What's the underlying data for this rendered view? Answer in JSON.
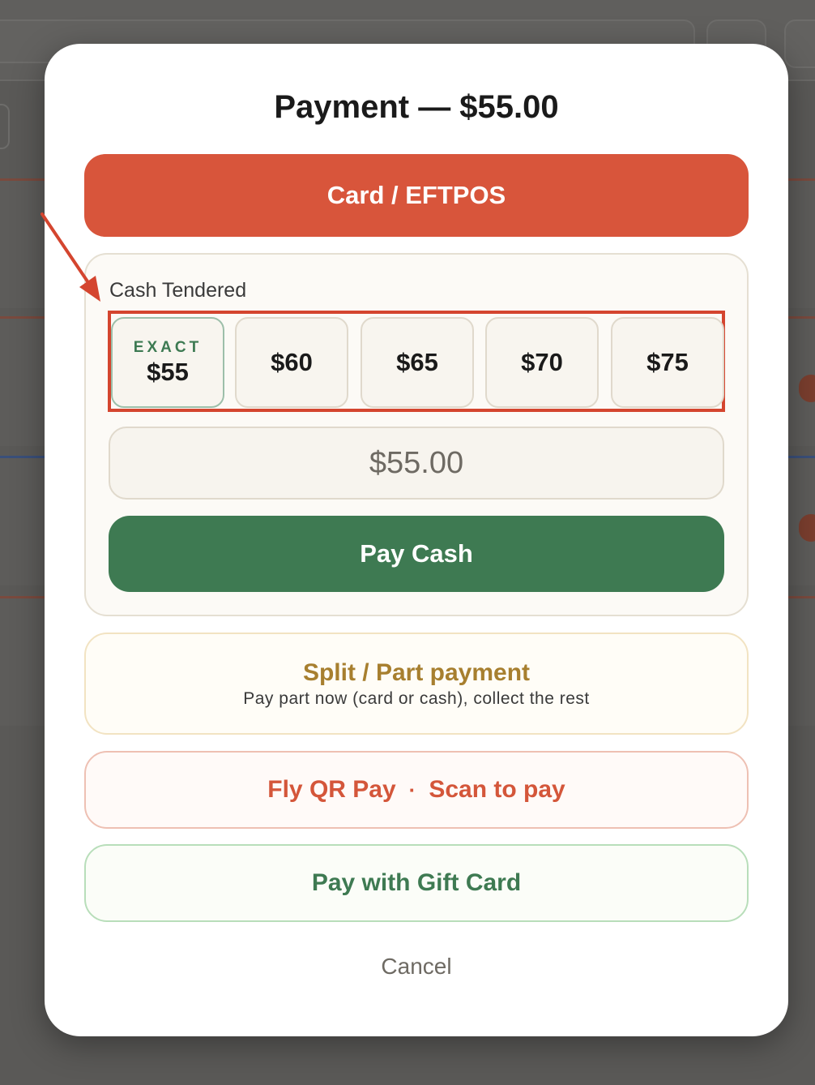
{
  "modal": {
    "title": "Payment — $55.00",
    "card_button": "Card / EFTPOS",
    "cash": {
      "label": "Cash Tendered",
      "quick_amounts": [
        {
          "tag": "EXACT",
          "value": "$55"
        },
        {
          "tag": "",
          "value": "$60"
        },
        {
          "tag": "",
          "value": "$65"
        },
        {
          "tag": "",
          "value": "$70"
        },
        {
          "tag": "",
          "value": "$75"
        }
      ],
      "tendered_value": "$55.00",
      "pay_button": "Pay Cash"
    },
    "split": {
      "title": "Split / Part payment",
      "subtitle": "Pay part now (card or cash), collect the rest"
    },
    "qr": {
      "label": "Fly QR Pay",
      "separator": "·",
      "action": "Scan to pay"
    },
    "gift_card": "Pay with Gift Card",
    "cancel": "Cancel"
  },
  "annotation": {
    "highlight_color": "#d4452f",
    "arrow_color": "#d4452f"
  },
  "colors": {
    "card": "#d8553b",
    "cash": "#3e7a52",
    "split": "#a77f2f",
    "qr": "#d4563a"
  }
}
